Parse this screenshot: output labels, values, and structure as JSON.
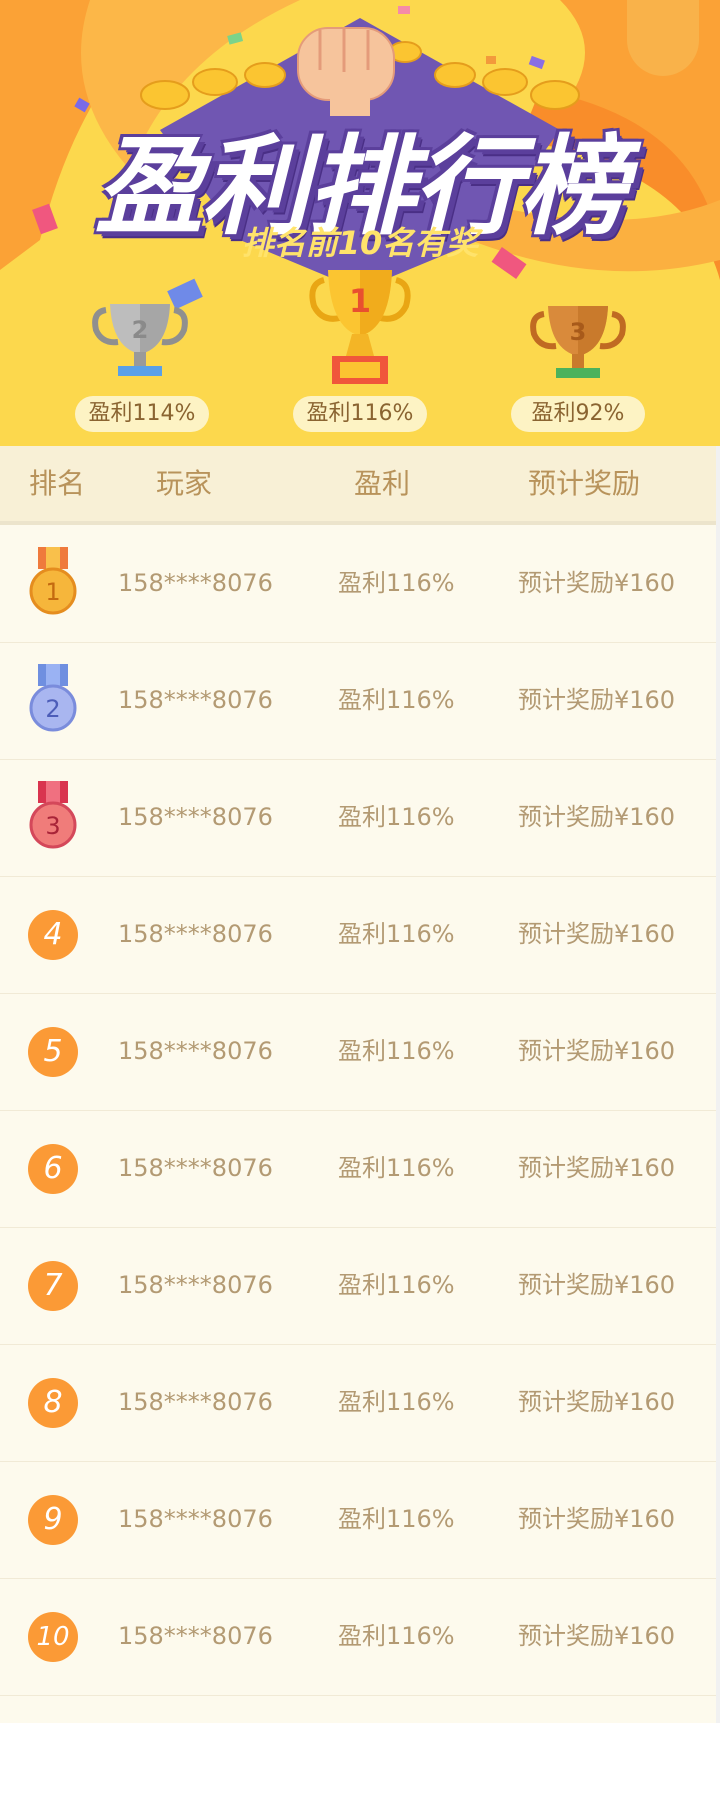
{
  "banner": {
    "title": "盈利排行榜",
    "subtitle": "排名前10名有奖",
    "podium": [
      {
        "rank": "2",
        "label": "盈利114%"
      },
      {
        "rank": "1",
        "label": "盈利116%"
      },
      {
        "rank": "3",
        "label": "盈利92%"
      }
    ]
  },
  "table": {
    "headers": {
      "rank": "排名",
      "player": "玩家",
      "profit": "盈利",
      "reward": "预计奖励"
    },
    "rows": [
      {
        "rank": "1",
        "player": "158****8076",
        "profit": "盈利116%",
        "reward": "预计奖励¥160"
      },
      {
        "rank": "2",
        "player": "158****8076",
        "profit": "盈利116%",
        "reward": "预计奖励¥160"
      },
      {
        "rank": "3",
        "player": "158****8076",
        "profit": "盈利116%",
        "reward": "预计奖励¥160"
      },
      {
        "rank": "4",
        "player": "158****8076",
        "profit": "盈利116%",
        "reward": "预计奖励¥160"
      },
      {
        "rank": "5",
        "player": "158****8076",
        "profit": "盈利116%",
        "reward": "预计奖励¥160"
      },
      {
        "rank": "6",
        "player": "158****8076",
        "profit": "盈利116%",
        "reward": "预计奖励¥160"
      },
      {
        "rank": "7",
        "player": "158****8076",
        "profit": "盈利116%",
        "reward": "预计奖励¥160"
      },
      {
        "rank": "8",
        "player": "158****8076",
        "profit": "盈利116%",
        "reward": "预计奖励¥160"
      },
      {
        "rank": "9",
        "player": "158****8076",
        "profit": "盈利116%",
        "reward": "预计奖励¥160"
      },
      {
        "rank": "10",
        "player": "158****8076",
        "profit": "盈利116%",
        "reward": "预计奖励¥160"
      }
    ]
  },
  "colors": {
    "banner_bg": "#fcd84d",
    "title_outline": "#5b3f9c",
    "accent_orange": "#fb9a36",
    "text_gold": "#b39a73",
    "gold_medal": "#f6b63b",
    "silver_medal": "#a9b6f0",
    "bronze_medal": "#f07c7a"
  }
}
